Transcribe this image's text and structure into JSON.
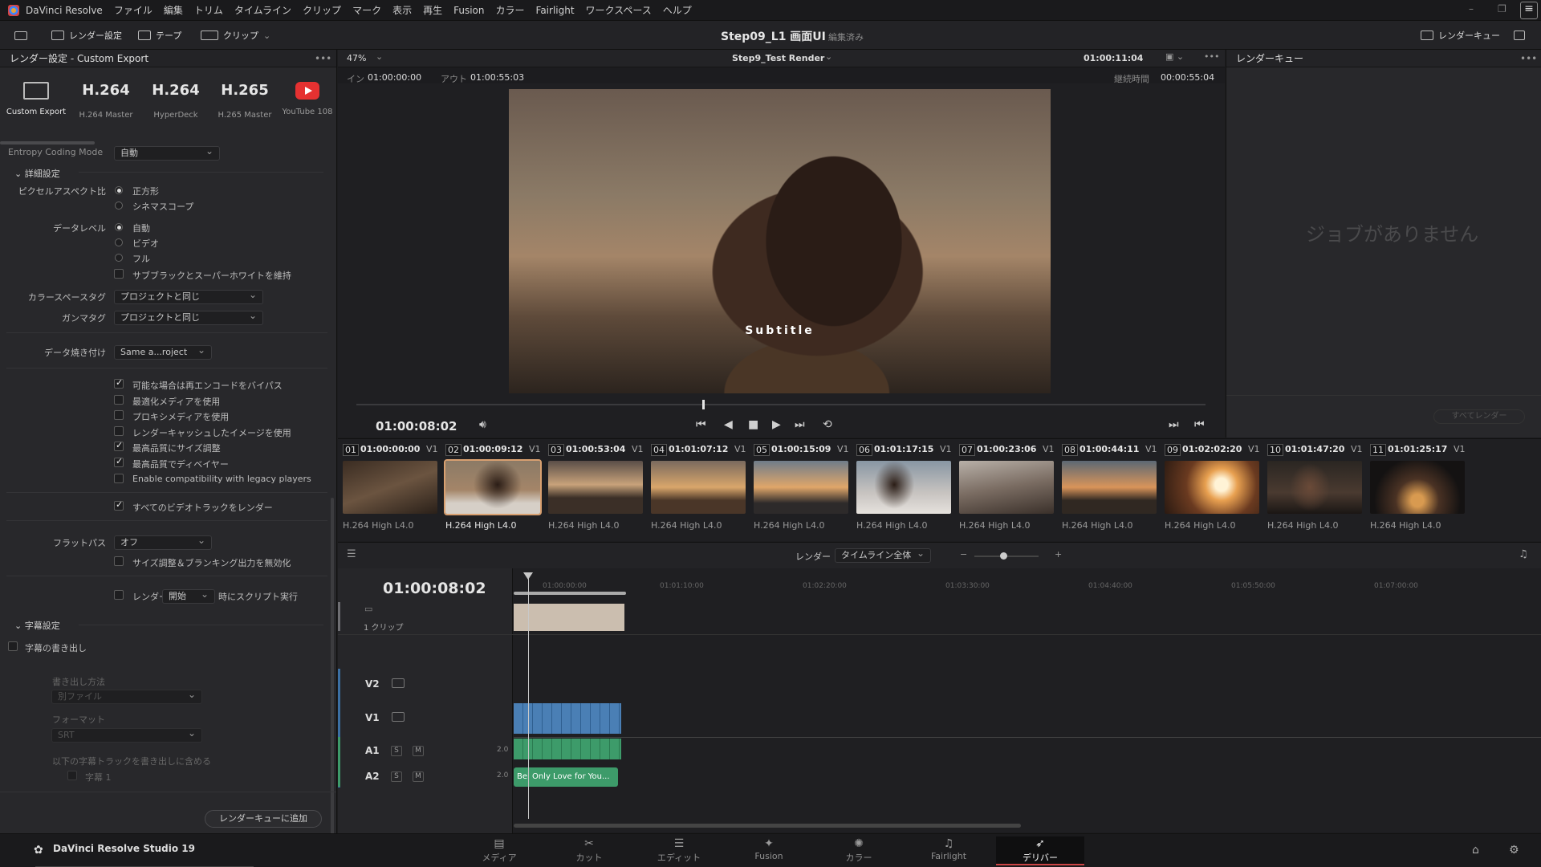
{
  "menubar": {
    "app_name": "DaVinci Resolve",
    "items": [
      "ファイル",
      "編集",
      "トリム",
      "タイムライン",
      "クリップ",
      "マーク",
      "表示",
      "再生",
      "Fusion",
      "カラー",
      "Fairlight",
      "ワークスペース",
      "ヘルプ"
    ]
  },
  "toolbar": {
    "render_settings": "レンダー設定",
    "tape": "テープ",
    "clip": "クリップ",
    "project_title": "Step09_L1 画面UI",
    "project_status": "編集済み",
    "render_queue": "レンダーキュー"
  },
  "left_panel": {
    "title": "レンダー設定 - Custom Export",
    "presets": [
      {
        "big": "",
        "label": "Custom Export"
      },
      {
        "big": "H.264",
        "label": "H.264 Master"
      },
      {
        "big": "H.264",
        "label": "HyperDeck"
      },
      {
        "big": "H.265",
        "label": "H.265 Master"
      },
      {
        "big": "",
        "label": "YouTube 108"
      }
    ],
    "entropy_label": "Entropy Coding Mode",
    "entropy_value": "自動",
    "advanced_title": "詳細設定",
    "pixel_aspect_label": "ピクセルアスペクト比",
    "pixel_aspect_options": [
      "正方形",
      "シネマスコープ"
    ],
    "data_level_label": "データレベル",
    "data_level_options": [
      "自動",
      "ビデオ",
      "フル"
    ],
    "retain_sub_black": "サブブラックとスーパーホワイトを維持",
    "color_space_tag_label": "カラースペースタグ",
    "color_space_tag_value": "プロジェクトと同じ",
    "gamma_tag_label": "ガンマタグ",
    "gamma_tag_value": "プロジェクトと同じ",
    "data_burn_label": "データ焼き付け",
    "data_burn_value": "Same a...roject",
    "checks": [
      {
        "label": "可能な場合は再エンコードをバイパス",
        "on": true
      },
      {
        "label": "最適化メディアを使用",
        "on": false
      },
      {
        "label": "プロキシメディアを使用",
        "on": false
      },
      {
        "label": "レンダーキャッシュしたイメージを使用",
        "on": false
      },
      {
        "label": "最高品質にサイズ調整",
        "on": true
      },
      {
        "label": "最高品質でディベイヤー",
        "on": true
      },
      {
        "label": "Enable compatibility with legacy players",
        "on": false
      }
    ],
    "render_all_tracks": "すべてのビデオトラックをレンダー",
    "flat_pass_label": "フラットパス",
    "flat_pass_value": "オフ",
    "disable_sizing": "サイズ調整＆ブランキング出力を無効化",
    "render_label": "レンダー",
    "render_value": "開始",
    "script_suffix": "時にスクリプト実行",
    "subtitle_settings": "字幕設定",
    "export_subtitle": "字幕の書き出し",
    "export_method_label": "書き出し方法",
    "export_method_value": "別ファイル",
    "format_label": "フォーマット",
    "format_value": "SRT",
    "include_tracks_label": "以下の字幕トラックを書き出しに含める",
    "subtitle_track": "字幕 1",
    "add_to_queue": "レンダーキューに追加"
  },
  "viewer": {
    "zoom": "47%",
    "timeline_name": "Step9_Test Render",
    "timecode_top": "01:00:11:04",
    "in_label": "イン",
    "in_value": "01:00:00:00",
    "out_label": "アウト",
    "out_value": "01:00:55:03",
    "duration_label": "継続時間",
    "duration_value": "00:00:55:04",
    "subtitle": "Subtitle",
    "current_tc": "01:00:08:02"
  },
  "queue": {
    "title": "レンダーキュー",
    "empty_text": "ジョブがありません",
    "render_all": "すべてレンダー"
  },
  "clips": [
    {
      "num": "01",
      "tc": "01:00:00:00",
      "track": "V1",
      "codec": "H.264 High L4.0"
    },
    {
      "num": "02",
      "tc": "01:00:09:12",
      "track": "V1",
      "codec": "H.264 High L4.0"
    },
    {
      "num": "03",
      "tc": "01:00:53:04",
      "track": "V1",
      "codec": "H.264 High L4.0"
    },
    {
      "num": "04",
      "tc": "01:01:07:12",
      "track": "V1",
      "codec": "H.264 High L4.0"
    },
    {
      "num": "05",
      "tc": "01:00:15:09",
      "track": "V1",
      "codec": "H.264 High L4.0"
    },
    {
      "num": "06",
      "tc": "01:01:17:15",
      "track": "V1",
      "codec": "H.264 High L4.0"
    },
    {
      "num": "07",
      "tc": "01:00:23:06",
      "track": "V1",
      "codec": "H.264 High L4.0"
    },
    {
      "num": "08",
      "tc": "01:00:44:11",
      "track": "V1",
      "codec": "H.264 High L4.0"
    },
    {
      "num": "09",
      "tc": "01:02:02:20",
      "track": "V1",
      "codec": "H.264 High L4.0"
    },
    {
      "num": "10",
      "tc": "01:01:47:20",
      "track": "V1",
      "codec": "H.264 High L4.0"
    },
    {
      "num": "11",
      "tc": "01:01:25:17",
      "track": "V1",
      "codec": "H.264 High L4.0"
    }
  ],
  "timeline": {
    "render_label": "レンダー",
    "render_scope": "タイムライン全体",
    "tc": "01:00:08:02",
    "clip_count": "1 クリップ",
    "ruler": [
      "01:00:00:00",
      "01:01:10:00",
      "01:02:20:00",
      "01:03:30:00",
      "01:04:40:00",
      "01:05:50:00",
      "01:07:00:00"
    ],
    "tracks": [
      {
        "name": "V2",
        "level": ""
      },
      {
        "name": "V1",
        "level": ""
      },
      {
        "name": "A1",
        "level": "2.0"
      },
      {
        "name": "A2",
        "level": "2.0"
      }
    ],
    "solo": "S",
    "mute": "M",
    "audio_clip_a2": "Bei Only Love for You..."
  },
  "bottomnav": {
    "brand": "DaVinci Resolve Studio 19",
    "items": [
      "メディア",
      "カット",
      "エディット",
      "Fusion",
      "カラー",
      "Fairlight",
      "デリバー"
    ]
  }
}
